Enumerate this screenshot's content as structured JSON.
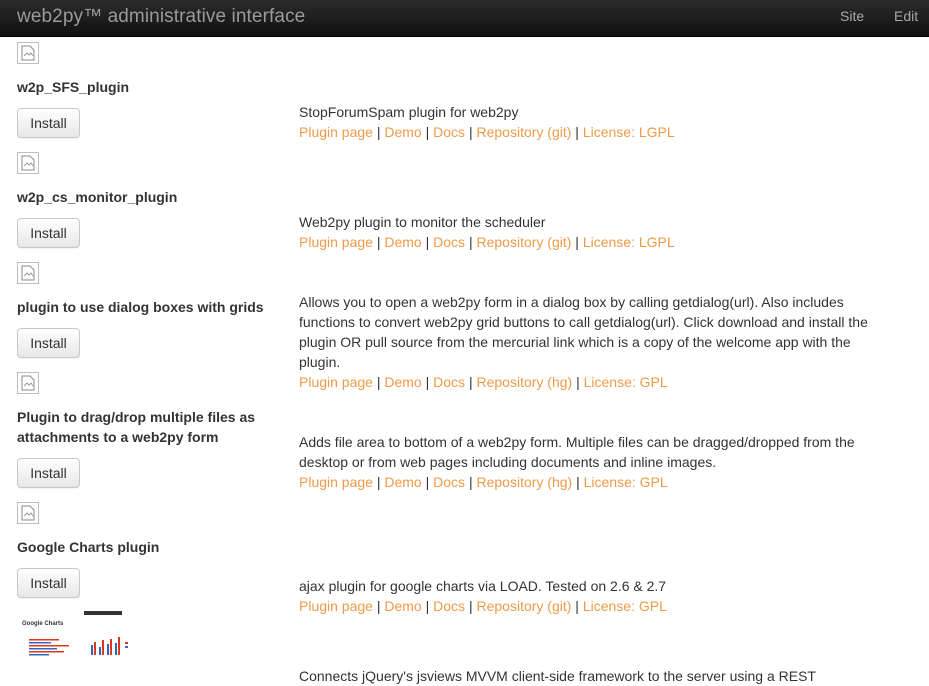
{
  "navbar": {
    "brand": "web2py™ administrative interface",
    "links": [
      "Site",
      "Edit"
    ]
  },
  "plugins": [
    {
      "name": "w2p_SFS_plugin",
      "install_label": "Install",
      "description": "StopForumSpam plugin for web2py",
      "links": [
        "Plugin page",
        "Demo",
        "Docs",
        "Repository (git)",
        "License: LGPL"
      ]
    },
    {
      "name": "w2p_cs_monitor_plugin",
      "install_label": "Install",
      "description": "Web2py plugin to monitor the scheduler",
      "links": [
        "Plugin page",
        "Demo",
        "Docs",
        "Repository (git)",
        "License: LGPL"
      ]
    },
    {
      "name": "plugin to use dialog boxes with grids",
      "install_label": "Install",
      "description": "Allows you to open a web2py form in a dialog box by calling getdialog(url). Also includes functions to convert web2py grid buttons to call getdialog(url). Click download and install the plugin OR pull source from the mercurial link which is a copy of the welcome app with the plugin.",
      "links": [
        "Plugin page",
        "Demo",
        "Docs",
        "Repository (hg)",
        "License: GPL"
      ]
    },
    {
      "name": "Plugin to drag/drop multiple files as attachments to a web2py form",
      "install_label": "Install",
      "description": "Adds file area to bottom of a web2py form. Multiple files can be dragged/dropped from the desktop or from web pages including documents and inline images.",
      "links": [
        "Plugin page",
        "Demo",
        "Docs",
        "Repository (hg)",
        "License: GPL"
      ]
    },
    {
      "name": "Google Charts plugin",
      "install_label": "Install",
      "description": "ajax plugin for google charts via LOAD. Tested on 2.6 & 2.7",
      "links": [
        "Plugin page",
        "Demo",
        "Docs",
        "Repository (git)",
        "License: GPL"
      ],
      "thumb_title": "Google Charts"
    },
    {
      "name": "",
      "description": "Connects jQuery's jsviews MVVM client-side framework to the server using a REST"
    }
  ]
}
